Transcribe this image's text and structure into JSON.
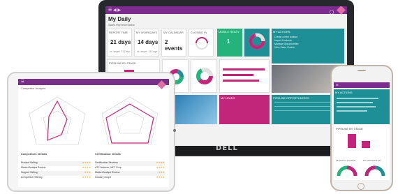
{
  "laptop": {
    "app_title": "My Daily",
    "subtitle": "Sales Representative",
    "brand": "DELL",
    "cards": {
      "report_time": {
        "label": "REPORT TIME",
        "value": "21 days",
        "note": "vs. target: 21 Days"
      },
      "workdays": {
        "label": "MY WORKDAYS",
        "value": "14 days",
        "note": "vs. target: 14 Days"
      },
      "calendar": {
        "label": "MY CALENDAR",
        "value": "2 events"
      },
      "closing": {
        "label": "CLOSING IN"
      },
      "green": {
        "label": "MOBILE READY",
        "value": "1"
      },
      "my_actions": {
        "label": "MY ACTIONS",
        "items": [
          "Create a new contact",
          "Import Contacts",
          "Manage Opportunities",
          "View Sales Orders"
        ]
      },
      "pipeline": {
        "label": "PIPELINE BY STAGE"
      },
      "my_leads": {
        "label": "MY LEADS"
      },
      "pipeline_opps": {
        "label": "PIPELINE OPPORTUNITIES"
      }
    }
  },
  "tablet": {
    "title": "Competitor Analysis",
    "chart_left": "Competitors: Details",
    "chart_right": "Certification: Details",
    "left_rows": [
      {
        "name": "Product Selling",
        "stars": "★★★★"
      },
      {
        "name": "Market Analyst Review",
        "stars": "★★★★"
      },
      {
        "name": "Support Selling",
        "stars": "★★★"
      },
      {
        "name": "Competitor Offering",
        "stars": "★★★★"
      }
    ],
    "right_rows": [
      {
        "name": "Certification Services",
        "stars": "★★★★"
      },
      {
        "name": "ATP Network, MFT Prep",
        "stars": "★★★★"
      },
      {
        "name": "Market Analyst Review",
        "stars": "★★★"
      },
      {
        "name": "Industry Scope",
        "stars": "★★★★"
      }
    ]
  },
  "phone": {
    "title": "MY ACTIONS",
    "section": "PIPELINE BY STAGE",
    "leads_by_source": "LEADS BY SOURCE",
    "opportunity": "BY OPPORTUNITY"
  },
  "colors": {
    "brand_purple": "#7b2d8c",
    "accent_magenta": "#c2267a",
    "accent_green": "#26b37b",
    "accent_teal": "#1f8f96"
  }
}
